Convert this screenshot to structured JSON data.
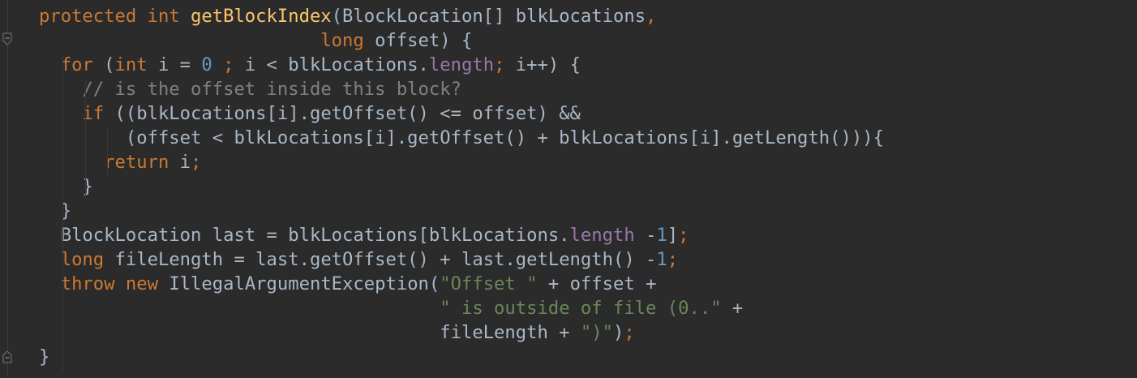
{
  "editor": {
    "theme": {
      "background": "#2b2b2b",
      "default": "#a9b7c6",
      "keyword": "#cc7832",
      "method_declaration": "#ffc66d",
      "number": "#6897bb",
      "comment": "#808080",
      "field": "#9876aa",
      "string": "#6a8759"
    },
    "gutter": {
      "fold_start_icon": "fold-collapse-icon",
      "fold_end_icon": "fold-end-icon"
    },
    "lines": [
      [
        {
          "t": "protected int ",
          "c": "kw"
        },
        {
          "t": "getBlockIndex",
          "c": "fn"
        },
        {
          "t": "(BlockLocation[] blkLocations",
          "c": ""
        },
        {
          "t": ",",
          "c": "kw"
        }
      ],
      [
        {
          "t": "                          ",
          "c": ""
        },
        {
          "t": "long ",
          "c": "kw"
        },
        {
          "t": "offset) {",
          "c": ""
        }
      ],
      [
        {
          "t": "  ",
          "c": ""
        },
        {
          "t": "for ",
          "c": "kw"
        },
        {
          "t": "(",
          "c": ""
        },
        {
          "t": "int ",
          "c": "kw"
        },
        {
          "t": "i = ",
          "c": ""
        },
        {
          "t": "0 ",
          "c": "num"
        },
        {
          "t": "; ",
          "c": "kw"
        },
        {
          "t": "i < blkLocations.",
          "c": ""
        },
        {
          "t": "length",
          "c": "fld"
        },
        {
          "t": "; ",
          "c": "kw"
        },
        {
          "t": "i++) {",
          "c": ""
        }
      ],
      [
        {
          "t": "    ",
          "c": ""
        },
        {
          "t": "// is the offset inside this block?",
          "c": "cm"
        }
      ],
      [
        {
          "t": "    ",
          "c": ""
        },
        {
          "t": "if ",
          "c": "kw"
        },
        {
          "t": "((blkLocations[i].getOffset() <= offset) &&",
          "c": ""
        }
      ],
      [
        {
          "t": "        (offset < blkLocations[i].getOffset() + blkLocations[i].getLength())){",
          "c": ""
        }
      ],
      [
        {
          "t": "      ",
          "c": ""
        },
        {
          "t": "return ",
          "c": "kw"
        },
        {
          "t": "i",
          "c": ""
        },
        {
          "t": ";",
          "c": "kw"
        }
      ],
      [
        {
          "t": "    }",
          "c": ""
        }
      ],
      [
        {
          "t": "  }",
          "c": ""
        }
      ],
      [
        {
          "t": "  BlockLocation last = blkLocations[blkLocations.",
          "c": ""
        },
        {
          "t": "length ",
          "c": "fld"
        },
        {
          "t": "-",
          "c": ""
        },
        {
          "t": "1",
          "c": "num"
        },
        {
          "t": "]",
          "c": ""
        },
        {
          "t": ";",
          "c": "kw"
        }
      ],
      [
        {
          "t": "  ",
          "c": ""
        },
        {
          "t": "long ",
          "c": "kw"
        },
        {
          "t": "fileLength = last.getOffset() + last.getLength() -",
          "c": ""
        },
        {
          "t": "1",
          "c": "num"
        },
        {
          "t": ";",
          "c": "kw"
        }
      ],
      [
        {
          "t": "  ",
          "c": ""
        },
        {
          "t": "throw new ",
          "c": "kw"
        },
        {
          "t": "IllegalArgumentException(",
          "c": ""
        },
        {
          "t": "\"Offset \" ",
          "c": "str"
        },
        {
          "t": "+ offset +",
          "c": ""
        }
      ],
      [
        {
          "t": "                                     ",
          "c": ""
        },
        {
          "t": "\" is outside of file (0..\" ",
          "c": "str"
        },
        {
          "t": "+",
          "c": ""
        }
      ],
      [
        {
          "t": "                                     fileLength + ",
          "c": ""
        },
        {
          "t": "\")\"",
          "c": "str"
        },
        {
          "t": ")",
          "c": ""
        },
        {
          "t": ";",
          "c": "kw"
        }
      ],
      [
        {
          "t": "}",
          "c": ""
        }
      ]
    ]
  }
}
